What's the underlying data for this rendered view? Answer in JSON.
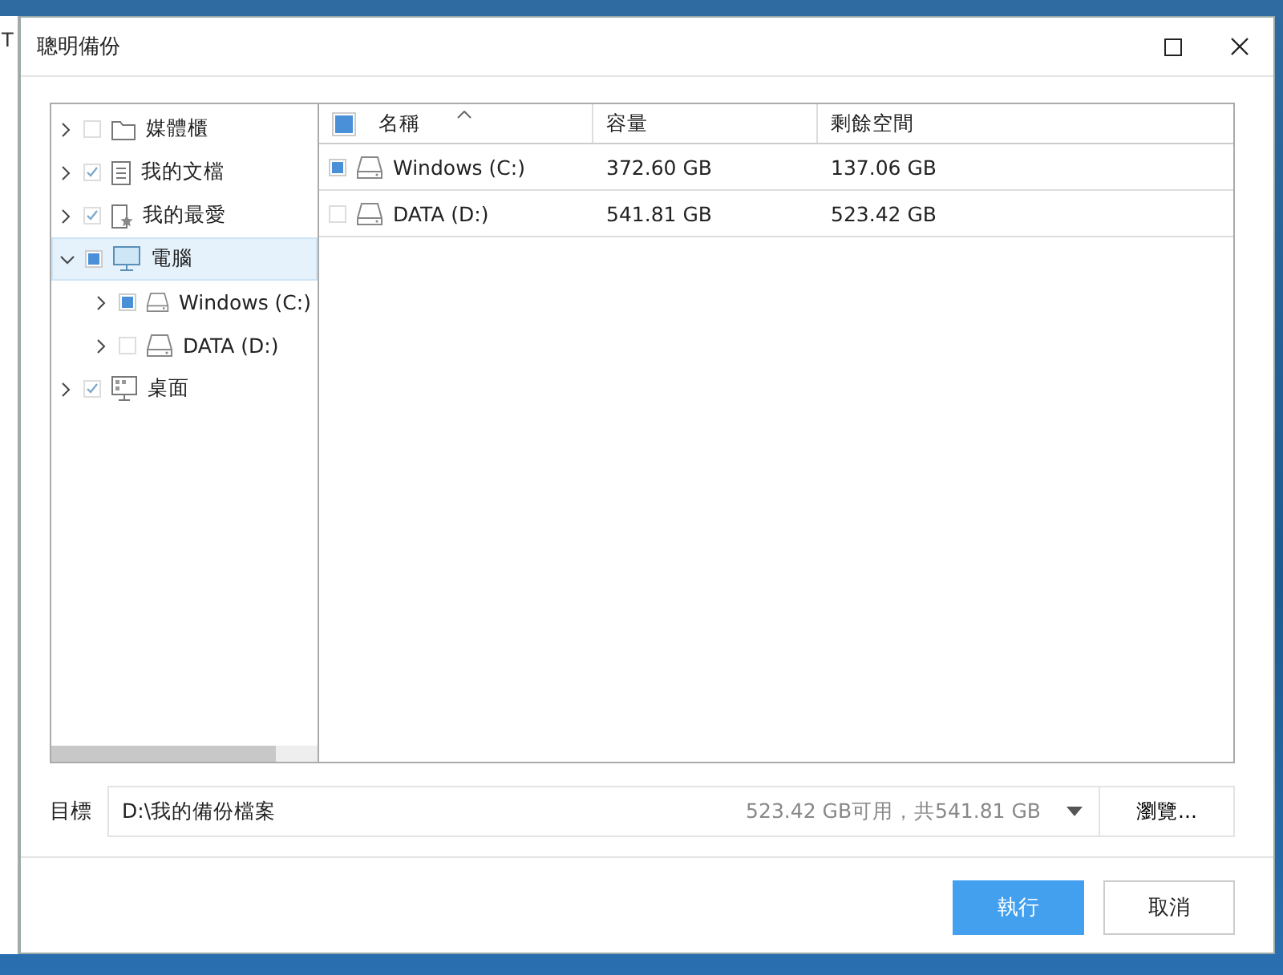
{
  "background_window": {
    "title": "T"
  },
  "window": {
    "title": "聰明備份"
  },
  "tree": [
    {
      "label": "媒體櫃",
      "kind": "folder",
      "checked": false,
      "partial": false,
      "expanded": false,
      "selected": false
    },
    {
      "label": "我的文檔",
      "kind": "document",
      "checked": true,
      "partial": false,
      "expanded": false,
      "selected": false
    },
    {
      "label": "我的最愛",
      "kind": "favorites",
      "checked": true,
      "partial": false,
      "expanded": false,
      "selected": false
    },
    {
      "label": "電腦",
      "kind": "computer",
      "checked": false,
      "partial": true,
      "expanded": true,
      "selected": true,
      "children": [
        {
          "label": "Windows (C:)",
          "kind": "drive",
          "checked": false,
          "partial": true,
          "expanded": false,
          "selected": false
        },
        {
          "label": "DATA (D:)",
          "kind": "drive",
          "checked": false,
          "partial": false,
          "expanded": false,
          "selected": false
        }
      ]
    },
    {
      "label": "桌面",
      "kind": "desktop",
      "checked": true,
      "partial": false,
      "expanded": false,
      "selected": false
    }
  ],
  "table": {
    "select_all": {
      "checked": false,
      "partial": true
    },
    "columns": [
      "名稱",
      "容量",
      "剩餘空間"
    ],
    "rows": [
      {
        "checked": false,
        "partial": true,
        "name": "Windows (C:)",
        "capacity": "372.60 GB",
        "free": "137.06 GB"
      },
      {
        "checked": false,
        "partial": false,
        "name": "DATA (D:)",
        "capacity": "541.81 GB",
        "free": "523.42 GB"
      }
    ]
  },
  "target": {
    "label": "目標",
    "value": "D:\\我的備份檔案",
    "info": "523.42 GB可用，共541.81 GB",
    "browse": "瀏覽..."
  },
  "buttons": [
    {
      "label": "執行",
      "primary": true
    },
    {
      "label": "取消",
      "primary": false
    }
  ]
}
